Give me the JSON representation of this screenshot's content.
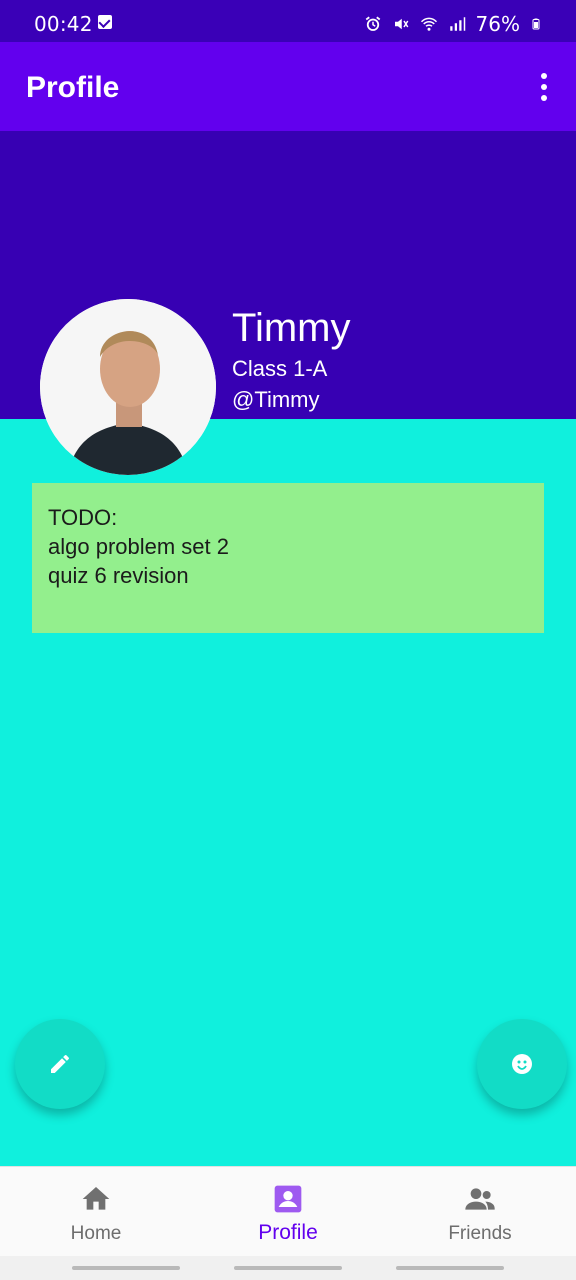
{
  "status_bar": {
    "time": "00:42",
    "battery": "76%",
    "icons": [
      "checkbox-icon",
      "alarm-icon",
      "mute-icon",
      "wifi-icon",
      "signal-icon",
      "battery-icon"
    ]
  },
  "app_bar": {
    "title": "Profile",
    "menu_icon": "more-vert-icon"
  },
  "profile": {
    "name": "Timmy",
    "class": "Class 1-A",
    "handle": "@Timmy"
  },
  "todo": {
    "lines": [
      "TODO:",
      "algo problem set 2",
      "quiz 6 revision"
    ]
  },
  "fabs": {
    "left_icon": "pencil-icon",
    "right_icon": "smiley-icon"
  },
  "bottom_nav": {
    "items": [
      {
        "label": "Home",
        "icon": "home-icon",
        "active": false
      },
      {
        "label": "Profile",
        "icon": "profile-icon",
        "active": true
      },
      {
        "label": "Friends",
        "icon": "friends-icon",
        "active": false
      }
    ]
  },
  "colors": {
    "status_bar": "#3A00B7",
    "app_bar": "#6200EE",
    "header": "#3700B3",
    "background": "#10F0DD",
    "todo_card": "#93EF8D",
    "fab": "#12DCC6",
    "active_nav": "#6200EE"
  }
}
